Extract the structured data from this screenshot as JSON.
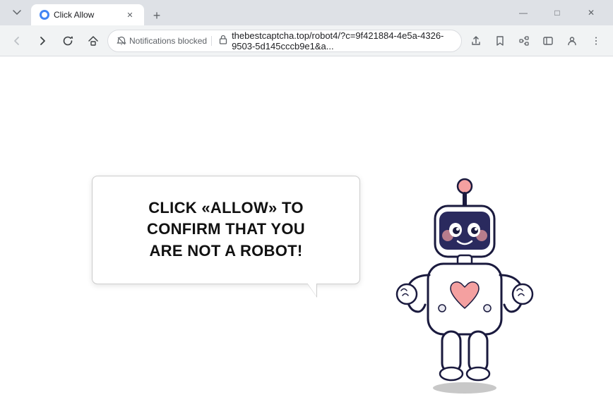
{
  "browser": {
    "tab": {
      "title": "Click Allow",
      "favicon_color": "#4285f4"
    },
    "window_controls": {
      "minimize": "—",
      "maximize": "□",
      "close": "✕",
      "chevron": "⌄"
    },
    "toolbar": {
      "back_label": "←",
      "forward_label": "→",
      "reload_label": "↻",
      "home_label": "⌂",
      "notifications_blocked": "Notifications blocked",
      "url": "thebestcaptcha.top/robot4/?c=9f421884-4e5a-4326-9503-5d145cccb9e1&a...",
      "share_label": "⬆",
      "bookmark_label": "☆",
      "extensions_label": "🧩",
      "sidebar_label": "⊡",
      "profile_label": "👤",
      "menu_label": "⋮"
    },
    "new_tab": "+"
  },
  "page": {
    "speech_text_line1": "CLICK «ALLOW» TO CONFIRM THAT YOU",
    "speech_text_line2": "ARE NOT A ROBOT!",
    "speech_text_combined": "CLICK «ALLOW» TO CONFIRM THAT YOU ARE NOT A ROBOT!"
  }
}
